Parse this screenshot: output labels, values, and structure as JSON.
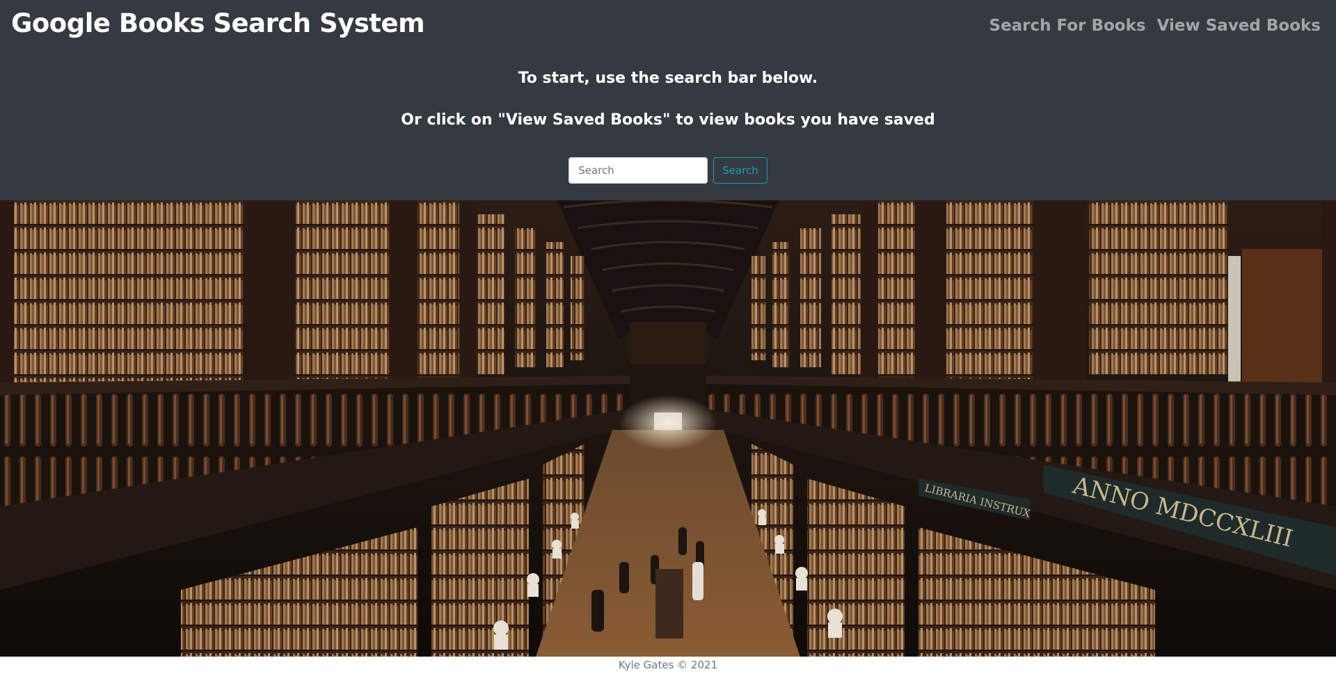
{
  "header": {
    "brand": "Google Books Search System",
    "nav": {
      "search_link": "Search For Books",
      "saved_link": "View Saved Books"
    },
    "lead_line_1": "To start, use the search bar below.",
    "lead_line_2": "Or click on \"View Saved Books\" to view books you have saved"
  },
  "search": {
    "placeholder": "Search",
    "value": "",
    "button_label": "Search"
  },
  "hero": {
    "inscription": "ANNO MDCCXLIII",
    "inscription_left": "LIBRARIA INSTRUX"
  },
  "footer": {
    "text": "Kyle Gates © 2021"
  },
  "colors": {
    "header_bg": "#343a40",
    "accent": "#17a2b8",
    "nav_link": "rgba(255,255,255,0.55)"
  }
}
